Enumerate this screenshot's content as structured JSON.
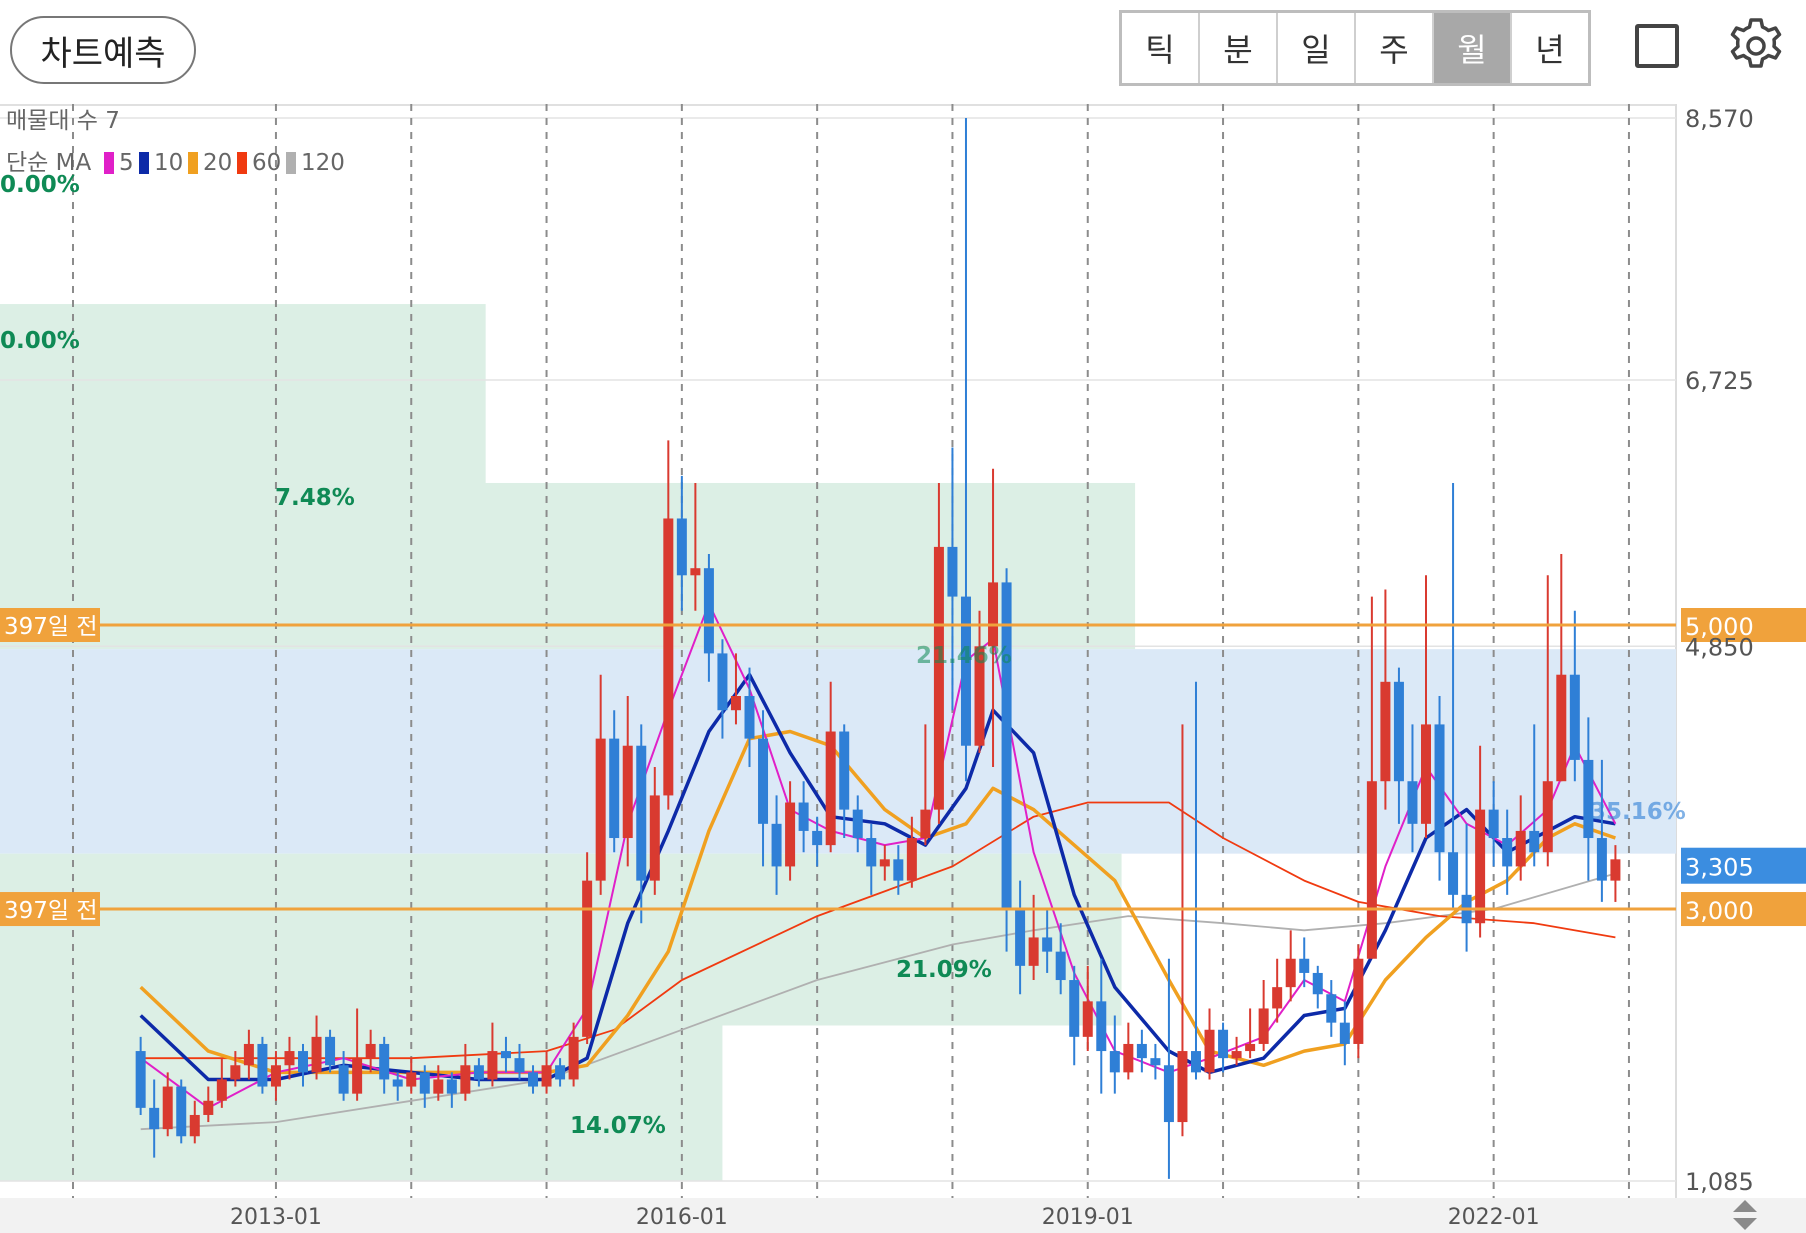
{
  "toolbar": {
    "predict_button": "차트예측",
    "period_tabs": [
      "틱",
      "분",
      "일",
      "주",
      "월",
      "년"
    ],
    "active_period": "월",
    "layout_icon": "square-icon",
    "settings_icon": "gear-icon"
  },
  "chart_data": {
    "type": "candlestick",
    "indicator_volume_profile_label": "매물대 수 7",
    "ma_label": "단순 MA",
    "ma_legend": [
      {
        "period": "5",
        "color": "#e020c8"
      },
      {
        "period": "10",
        "color": "#0d2aa8"
      },
      {
        "period": "20",
        "color": "#f0a020"
      },
      {
        "period": "60",
        "color": "#f03a10"
      },
      {
        "period": "120",
        "color": "#b0b0b0"
      }
    ],
    "y_ticks": [
      "8,570",
      "6,725",
      "4,850",
      "1,085"
    ],
    "y_tick_values": [
      8570,
      6725,
      4850,
      1085
    ],
    "ylim": [
      1085,
      8570
    ],
    "x_ticks": [
      "2013-01",
      "2016-01",
      "2019-01",
      "2022-01"
    ],
    "x_tick_years": [
      2013,
      2016,
      2019,
      2022
    ],
    "xlim": [
      2012.0,
      2024.75
    ],
    "gridlines_years": [
      2011.5,
      2014,
      2015,
      2017,
      2018,
      2020,
      2021,
      2023
    ],
    "volume_profile": [
      {
        "from": 6000,
        "to": 7260,
        "to_year": 2014.55,
        "label": "7.48%"
      },
      {
        "from": 4830,
        "to": 6000,
        "to_year": 2019.35,
        "label": "0.00%"
      },
      {
        "from": 3390,
        "to": 4830,
        "to_year": 2024.75,
        "label": "0.00%"
      },
      {
        "from": 2180,
        "to": 3390,
        "to_year": 2019.25,
        "label": "21.09%"
      },
      {
        "from": 1085,
        "to": 2180,
        "to_year": 2016.3,
        "label": "14.07%"
      }
    ],
    "profile_labels_top": [
      "0.00%",
      "0.00%"
    ],
    "profile_overlap_labels": [
      "21.46%",
      "35.16%"
    ],
    "lines": [
      {
        "value": 5000,
        "label_left": "397일 전",
        "label_right": "5,000",
        "color": "#f0a23c"
      },
      {
        "value": 3000,
        "label_left": "397일 전",
        "label_right": "3,000",
        "color": "#f0a23c"
      }
    ],
    "current_price": {
      "value": 3305,
      "label": "3,305",
      "color": "#3b8de0"
    },
    "candles": [
      [
        2012.0,
        2000,
        1600,
        2100,
        1550
      ],
      [
        2012.1,
        1600,
        1450,
        1800,
        1250
      ],
      [
        2012.2,
        1450,
        1750,
        1850,
        1400
      ],
      [
        2012.3,
        1750,
        1400,
        1800,
        1350
      ],
      [
        2012.4,
        1400,
        1550,
        1650,
        1350
      ],
      [
        2012.5,
        1550,
        1650,
        1750,
        1500
      ],
      [
        2012.6,
        1650,
        1800,
        1950,
        1600
      ],
      [
        2012.7,
        1800,
        1900,
        2000,
        1750
      ],
      [
        2012.8,
        1900,
        2050,
        2150,
        1800
      ],
      [
        2012.9,
        2050,
        1750,
        2100,
        1700
      ],
      [
        2013.0,
        1750,
        1900,
        2000,
        1650
      ],
      [
        2013.1,
        1900,
        2000,
        2100,
        1800
      ],
      [
        2013.2,
        2000,
        1850,
        2050,
        1750
      ],
      [
        2013.3,
        1850,
        2100,
        2250,
        1800
      ],
      [
        2013.4,
        2100,
        1900,
        2150,
        1850
      ],
      [
        2013.5,
        1900,
        1700,
        2000,
        1650
      ],
      [
        2013.6,
        1700,
        1950,
        2300,
        1650
      ],
      [
        2013.7,
        1950,
        2050,
        2150,
        1850
      ],
      [
        2013.8,
        2050,
        1800,
        2100,
        1700
      ],
      [
        2013.9,
        1800,
        1750,
        1850,
        1650
      ],
      [
        2014.0,
        1750,
        1850,
        1950,
        1700
      ],
      [
        2014.1,
        1850,
        1700,
        1900,
        1600
      ],
      [
        2014.2,
        1700,
        1800,
        1900,
        1650
      ],
      [
        2014.3,
        1800,
        1700,
        1850,
        1600
      ],
      [
        2014.4,
        1700,
        1900,
        2050,
        1650
      ],
      [
        2014.5,
        1900,
        1800,
        1950,
        1750
      ],
      [
        2014.6,
        1800,
        2000,
        2200,
        1750
      ],
      [
        2014.7,
        2000,
        1950,
        2100,
        1850
      ],
      [
        2014.8,
        1950,
        1850,
        2050,
        1800
      ],
      [
        2014.9,
        1850,
        1750,
        1900,
        1700
      ],
      [
        2015.0,
        1750,
        1900,
        2000,
        1700
      ],
      [
        2015.1,
        1900,
        1800,
        1950,
        1750
      ],
      [
        2015.2,
        1800,
        2100,
        2200,
        1750
      ],
      [
        2015.3,
        2100,
        3200,
        3400,
        2050
      ],
      [
        2015.4,
        3200,
        4200,
        4650,
        3100
      ],
      [
        2015.5,
        4200,
        3500,
        4400,
        3400
      ],
      [
        2015.6,
        3500,
        4150,
        4500,
        3300
      ],
      [
        2015.7,
        4150,
        3200,
        4300,
        2900
      ],
      [
        2015.8,
        3200,
        3800,
        4000,
        3100
      ],
      [
        2015.9,
        3800,
        5750,
        6300,
        3700
      ],
      [
        2016.0,
        5750,
        5350,
        6050,
        5100
      ],
      [
        2016.1,
        5350,
        5400,
        6000,
        5100
      ],
      [
        2016.2,
        5400,
        4800,
        5500,
        4600
      ],
      [
        2016.3,
        4800,
        4400,
        4900,
        4200
      ],
      [
        2016.4,
        4400,
        4500,
        4800,
        4300
      ],
      [
        2016.5,
        4500,
        4200,
        4700,
        4000
      ],
      [
        2016.6,
        4200,
        3600,
        4400,
        3300
      ],
      [
        2016.7,
        3600,
        3300,
        3800,
        3100
      ],
      [
        2016.8,
        3300,
        3750,
        3900,
        3200
      ],
      [
        2016.9,
        3750,
        3550,
        3900,
        3400
      ],
      [
        2017.0,
        3550,
        3450,
        3650,
        3300
      ],
      [
        2017.1,
        3450,
        4250,
        4600,
        3400
      ],
      [
        2017.2,
        4250,
        3700,
        4300,
        3500
      ],
      [
        2017.3,
        3700,
        3500,
        3800,
        3400
      ],
      [
        2017.4,
        3500,
        3300,
        3600,
        3100
      ],
      [
        2017.5,
        3300,
        3350,
        3450,
        3200
      ],
      [
        2017.6,
        3350,
        3200,
        3450,
        3100
      ],
      [
        2017.7,
        3200,
        3500,
        3650,
        3150
      ],
      [
        2017.8,
        3500,
        3700,
        4300,
        3450
      ],
      [
        2017.9,
        3700,
        5550,
        6000,
        3600
      ],
      [
        2018.0,
        5550,
        5200,
        6250,
        4400
      ],
      [
        2018.1,
        5200,
        4150,
        8570,
        3900
      ],
      [
        2018.2,
        4150,
        4850,
        5100,
        4100
      ],
      [
        2018.3,
        4850,
        5300,
        6100,
        4000
      ],
      [
        2018.4,
        5300,
        3000,
        5400,
        2700
      ],
      [
        2018.5,
        3000,
        2600,
        3200,
        2400
      ],
      [
        2018.6,
        2600,
        2800,
        3100,
        2500
      ],
      [
        2018.7,
        2800,
        2700,
        3000,
        2550
      ],
      [
        2018.8,
        2700,
        2500,
        2900,
        2400
      ],
      [
        2018.9,
        2500,
        2100,
        2600,
        1900
      ],
      [
        2019.0,
        2100,
        2350,
        2600,
        2000
      ],
      [
        2019.1,
        2350,
        2000,
        2650,
        1700
      ],
      [
        2019.2,
        2000,
        1850,
        2250,
        1700
      ],
      [
        2019.3,
        1850,
        2050,
        2200,
        1800
      ],
      [
        2019.4,
        2050,
        1950,
        2150,
        1850
      ],
      [
        2019.5,
        1950,
        1900,
        2050,
        1800
      ],
      [
        2019.6,
        1900,
        1500,
        2650,
        1100
      ],
      [
        2019.7,
        1500,
        2000,
        4300,
        1400
      ],
      [
        2019.8,
        2000,
        1850,
        4600,
        1800
      ],
      [
        2019.9,
        1850,
        2150,
        2300,
        1800
      ],
      [
        2020.0,
        2150,
        1950,
        2200,
        1850
      ],
      [
        2020.1,
        1950,
        2000,
        2100,
        1900
      ],
      [
        2020.2,
        2000,
        2050,
        2300,
        1950
      ],
      [
        2020.3,
        2050,
        2300,
        2500,
        2000
      ],
      [
        2020.4,
        2300,
        2450,
        2650,
        2200
      ],
      [
        2020.5,
        2450,
        2650,
        2850,
        2350
      ],
      [
        2020.6,
        2650,
        2550,
        2800,
        2450
      ],
      [
        2020.7,
        2550,
        2400,
        2600,
        2300
      ],
      [
        2020.8,
        2400,
        2200,
        2500,
        2100
      ],
      [
        2020.9,
        2200,
        2050,
        2350,
        1900
      ],
      [
        2021.0,
        2050,
        2650,
        2750,
        1950
      ],
      [
        2021.1,
        2650,
        3900,
        5200,
        3000
      ],
      [
        2021.2,
        3900,
        4600,
        5250,
        3700
      ],
      [
        2021.3,
        4600,
        3900,
        4700,
        3600
      ],
      [
        2021.4,
        3900,
        3600,
        4300,
        3400
      ],
      [
        2021.5,
        3600,
        4300,
        5350,
        3500
      ],
      [
        2021.6,
        4300,
        3400,
        4500,
        3200
      ],
      [
        2021.7,
        3400,
        3100,
        6000,
        3000
      ],
      [
        2021.8,
        3100,
        2900,
        3600,
        2700
      ],
      [
        2021.9,
        2900,
        3700,
        4150,
        2800
      ],
      [
        2022.0,
        3700,
        3500,
        3900,
        3300
      ],
      [
        2022.1,
        3500,
        3300,
        3700,
        3100
      ],
      [
        2022.2,
        3300,
        3550,
        3800,
        3200
      ],
      [
        2022.3,
        3550,
        3400,
        4300,
        3300
      ],
      [
        2022.4,
        3400,
        3900,
        5350,
        3300
      ],
      [
        2022.5,
        3900,
        4650,
        5500,
        3900
      ],
      [
        2022.6,
        4650,
        4050,
        5100,
        3900
      ],
      [
        2022.7,
        4050,
        3500,
        4350,
        3200
      ],
      [
        2022.8,
        3500,
        3200,
        4050,
        3050
      ],
      [
        2022.9,
        3200,
        3350,
        3450,
        3050
      ]
    ],
    "ma_series": {
      "5": [
        [
          2012.0,
          1950
        ],
        [
          2012.5,
          1600
        ],
        [
          2013.0,
          1850
        ],
        [
          2013.5,
          1950
        ],
        [
          2014.0,
          1800
        ],
        [
          2014.5,
          1850
        ],
        [
          2015.0,
          1850
        ],
        [
          2015.3,
          2300
        ],
        [
          2015.6,
          3600
        ],
        [
          2015.9,
          4400
        ],
        [
          2016.2,
          5150
        ],
        [
          2016.5,
          4550
        ],
        [
          2016.8,
          3700
        ],
        [
          2017.1,
          3550
        ],
        [
          2017.5,
          3450
        ],
        [
          2017.8,
          3500
        ],
        [
          2018.1,
          4750
        ],
        [
          2018.3,
          4900
        ],
        [
          2018.6,
          3400
        ],
        [
          2018.9,
          2550
        ],
        [
          2019.2,
          2000
        ],
        [
          2019.6,
          1850
        ],
        [
          2019.9,
          1950
        ],
        [
          2020.3,
          2100
        ],
        [
          2020.6,
          2500
        ],
        [
          2020.9,
          2350
        ],
        [
          2021.2,
          3300
        ],
        [
          2021.5,
          4000
        ],
        [
          2021.8,
          3600
        ],
        [
          2022.1,
          3450
        ],
        [
          2022.4,
          3700
        ],
        [
          2022.6,
          4150
        ],
        [
          2022.9,
          3600
        ]
      ],
      "10": [
        [
          2012.0,
          2250
        ],
        [
          2012.5,
          1800
        ],
        [
          2013.0,
          1800
        ],
        [
          2013.5,
          1900
        ],
        [
          2014.0,
          1850
        ],
        [
          2014.5,
          1800
        ],
        [
          2015.0,
          1800
        ],
        [
          2015.3,
          1950
        ],
        [
          2015.6,
          2900
        ],
        [
          2015.9,
          3550
        ],
        [
          2016.2,
          4250
        ],
        [
          2016.5,
          4650
        ],
        [
          2016.8,
          4100
        ],
        [
          2017.1,
          3650
        ],
        [
          2017.5,
          3600
        ],
        [
          2017.8,
          3450
        ],
        [
          2018.1,
          3850
        ],
        [
          2018.3,
          4400
        ],
        [
          2018.6,
          4100
        ],
        [
          2018.9,
          3100
        ],
        [
          2019.2,
          2450
        ],
        [
          2019.6,
          2000
        ],
        [
          2019.9,
          1850
        ],
        [
          2020.3,
          1950
        ],
        [
          2020.6,
          2250
        ],
        [
          2020.9,
          2300
        ],
        [
          2021.2,
          2850
        ],
        [
          2021.5,
          3500
        ],
        [
          2021.8,
          3700
        ],
        [
          2022.1,
          3400
        ],
        [
          2022.4,
          3550
        ],
        [
          2022.6,
          3650
        ],
        [
          2022.9,
          3600
        ]
      ],
      "20": [
        [
          2012.0,
          2450
        ],
        [
          2012.5,
          2000
        ],
        [
          2013.0,
          1850
        ],
        [
          2013.5,
          1850
        ],
        [
          2014.0,
          1850
        ],
        [
          2014.5,
          1850
        ],
        [
          2015.0,
          1850
        ],
        [
          2015.3,
          1900
        ],
        [
          2015.6,
          2250
        ],
        [
          2015.9,
          2700
        ],
        [
          2016.2,
          3550
        ],
        [
          2016.5,
          4200
        ],
        [
          2016.8,
          4250
        ],
        [
          2017.1,
          4150
        ],
        [
          2017.5,
          3700
        ],
        [
          2017.8,
          3500
        ],
        [
          2018.1,
          3600
        ],
        [
          2018.3,
          3850
        ],
        [
          2018.6,
          3700
        ],
        [
          2018.9,
          3450
        ],
        [
          2019.2,
          3200
        ],
        [
          2019.6,
          2500
        ],
        [
          2019.9,
          2000
        ],
        [
          2020.3,
          1900
        ],
        [
          2020.6,
          2000
        ],
        [
          2020.9,
          2050
        ],
        [
          2021.2,
          2500
        ],
        [
          2021.5,
          2800
        ],
        [
          2021.8,
          3050
        ],
        [
          2022.1,
          3200
        ],
        [
          2022.4,
          3500
        ],
        [
          2022.6,
          3600
        ],
        [
          2022.9,
          3500
        ]
      ],
      "60": [
        [
          2012.0,
          1950
        ],
        [
          2013.0,
          1950
        ],
        [
          2014.0,
          1950
        ],
        [
          2015.0,
          2000
        ],
        [
          2015.5,
          2150
        ],
        [
          2016.0,
          2500
        ],
        [
          2017.0,
          2950
        ],
        [
          2018.0,
          3300
        ],
        [
          2018.6,
          3650
        ],
        [
          2019.0,
          3750
        ],
        [
          2019.6,
          3750
        ],
        [
          2020.0,
          3500
        ],
        [
          2020.6,
          3200
        ],
        [
          2021.0,
          3050
        ],
        [
          2021.6,
          2950
        ],
        [
          2022.3,
          2900
        ],
        [
          2022.9,
          2800
        ]
      ],
      "120": [
        [
          2012.0,
          1450
        ],
        [
          2013.0,
          1500
        ],
        [
          2014.0,
          1650
        ],
        [
          2015.0,
          1800
        ],
        [
          2016.0,
          2150
        ],
        [
          2017.0,
          2500
        ],
        [
          2018.0,
          2750
        ],
        [
          2018.6,
          2850
        ],
        [
          2019.3,
          2950
        ],
        [
          2020.0,
          2900
        ],
        [
          2020.6,
          2850
        ],
        [
          2021.2,
          2900
        ],
        [
          2022.0,
          3000
        ],
        [
          2022.9,
          3250
        ]
      ]
    }
  }
}
